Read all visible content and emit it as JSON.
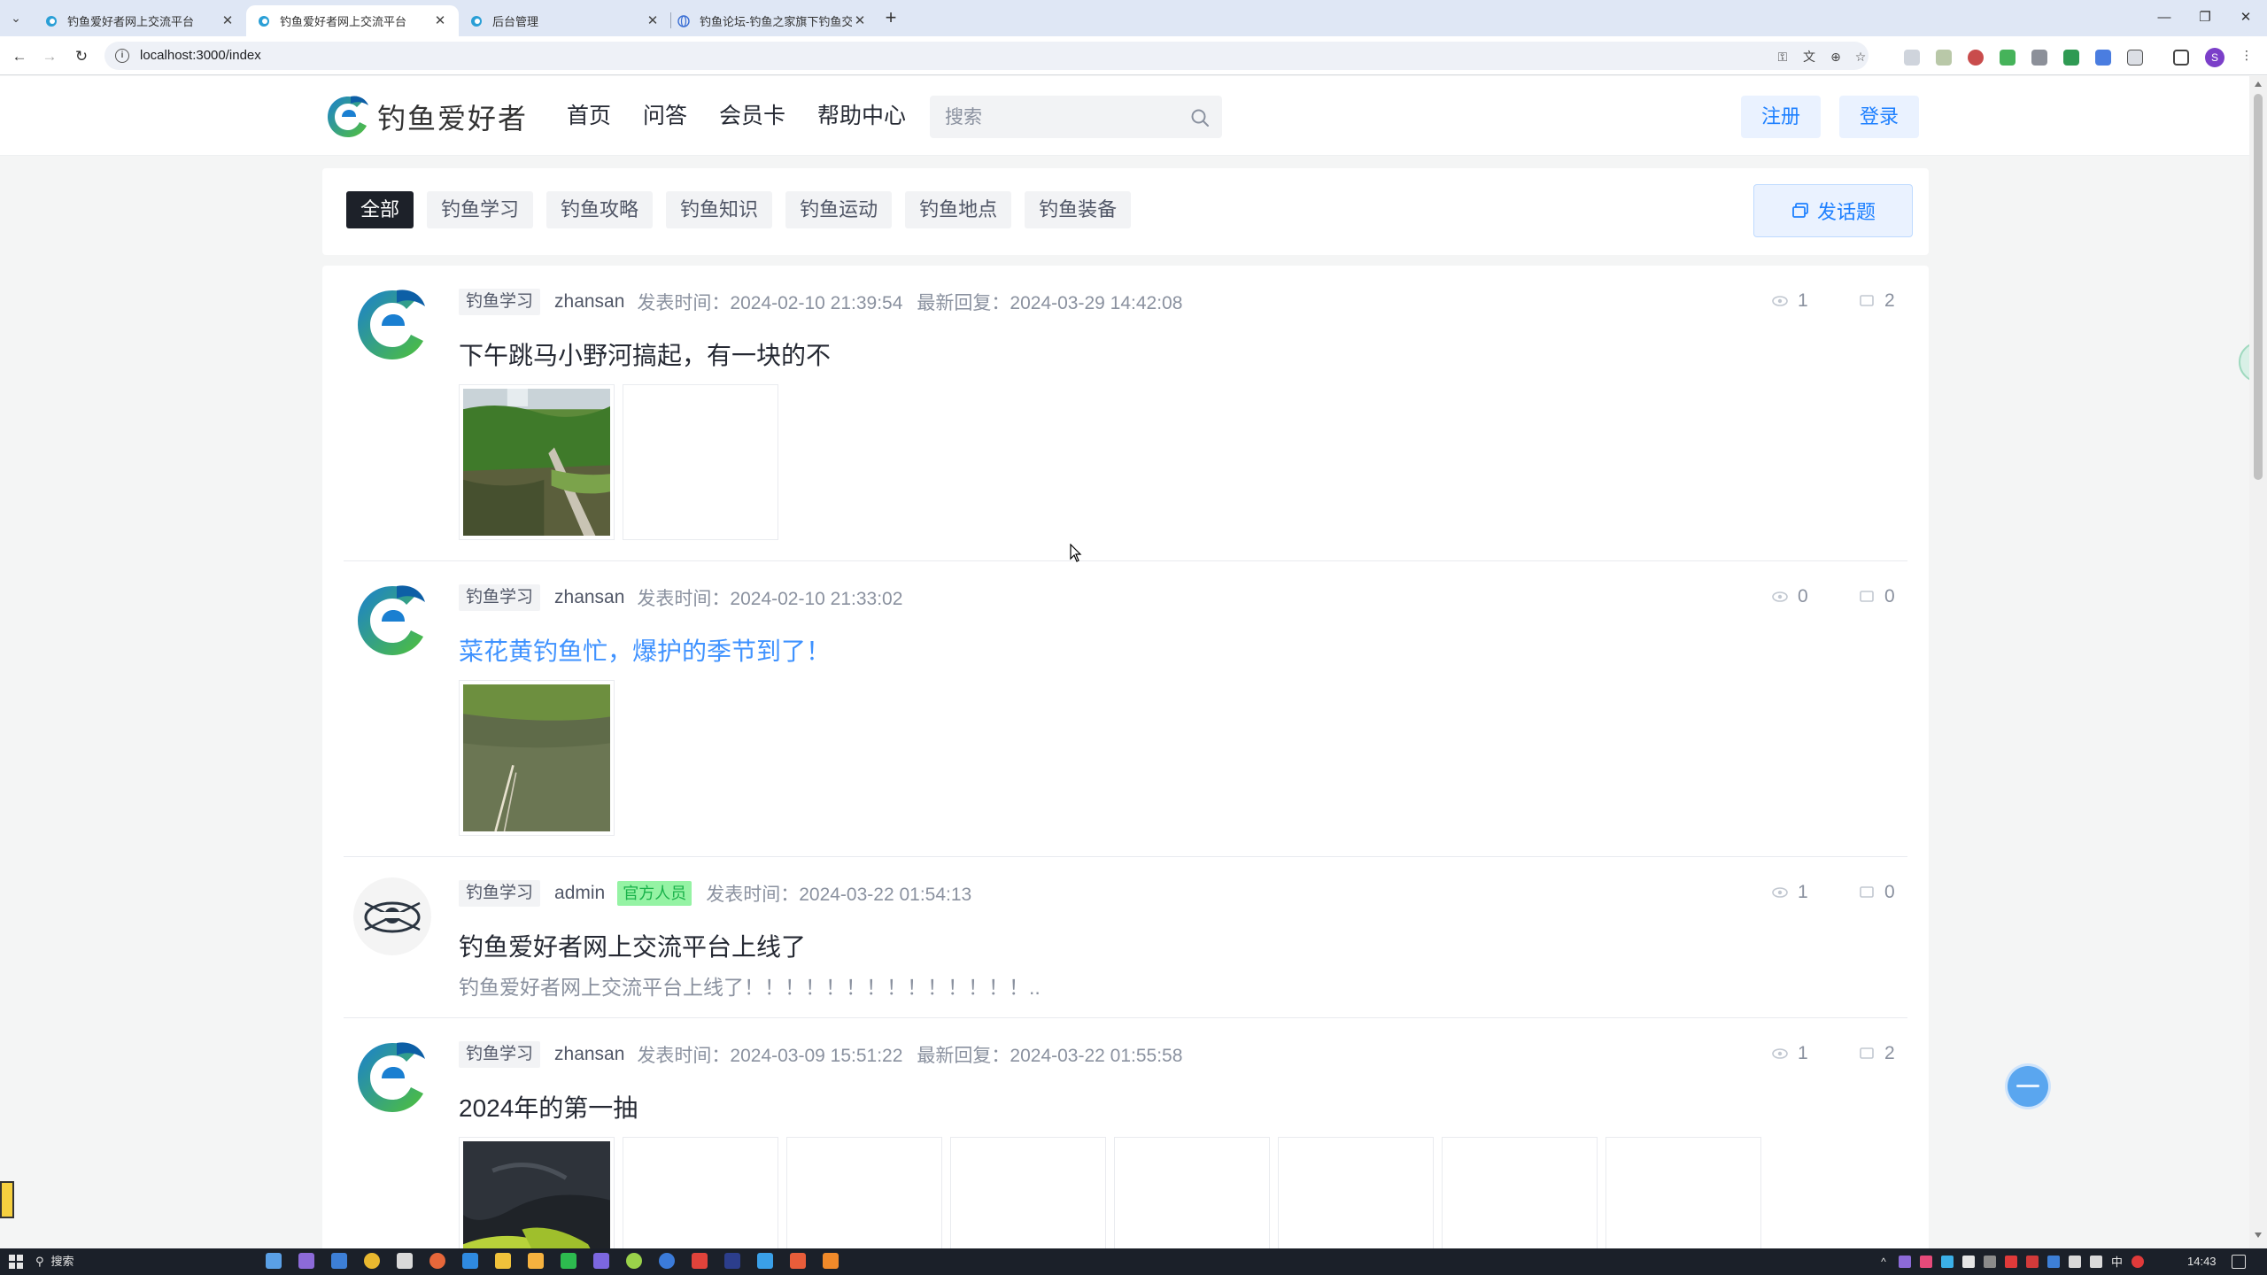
{
  "browser": {
    "tabs": [
      {
        "title": "钓鱼爱好者网上交流平台",
        "active": false
      },
      {
        "title": "钓鱼爱好者网上交流平台",
        "active": true
      },
      {
        "title": "后台管理",
        "active": false
      },
      {
        "title": "钓鱼论坛-钓鱼之家旗下钓鱼交...",
        "active": false
      }
    ],
    "url": "localhost:3000/index"
  },
  "header": {
    "logo_text": "钓鱼爱好者",
    "nav": [
      "首页",
      "问答",
      "会员卡",
      "帮助中心"
    ],
    "search_placeholder": "搜索",
    "register_label": "注册",
    "login_label": "登录"
  },
  "filters": {
    "chips": [
      "全部",
      "钓鱼学习",
      "钓鱼攻略",
      "钓鱼知识",
      "钓鱼运动",
      "钓鱼地点",
      "钓鱼装备"
    ],
    "active_index": 0,
    "post_button_label": "发话题"
  },
  "posts": [
    {
      "tag": "钓鱼学习",
      "author": "zhansan",
      "official_badge": "",
      "published": "发表时间：2024-02-10 21:39:54",
      "last_reply": "最新回复：2024-03-29 14:42:08",
      "views": "1",
      "comments": "2",
      "title": "下午跳马小野河搞起，有一块的不",
      "excerpt": ""
    },
    {
      "tag": "钓鱼学习",
      "author": "zhansan",
      "official_badge": "",
      "published": "发表时间：2024-02-10 21:33:02",
      "last_reply": "",
      "views": "0",
      "comments": "0",
      "title": "菜花黄钓鱼忙，爆护的季节到了！",
      "excerpt": ""
    },
    {
      "tag": "钓鱼学习",
      "author": "admin",
      "official_badge": "官方人员",
      "published": "发表时间：2024-03-22 01:54:13",
      "last_reply": "",
      "views": "1",
      "comments": "0",
      "title": "钓鱼爱好者网上交流平台上线了",
      "excerpt": "钓鱼爱好者网上交流平台上线了！！！！！！！！！！！！！！.."
    },
    {
      "tag": "钓鱼学习",
      "author": "zhansan",
      "official_badge": "",
      "published": "发表时间：2024-03-09 15:51:22",
      "last_reply": "最新回复：2024-03-22 01:55:58",
      "views": "1",
      "comments": "2",
      "title": "2024年的第一抽",
      "excerpt": ""
    }
  ],
  "taskbar": {
    "search_label": "搜索",
    "ime": "中",
    "time": "14:43"
  },
  "colors": {
    "accent": "#1e80ff",
    "accent_light": "#eaf2ff",
    "official_bg": "#95f3a4",
    "official_text": "#19b24a"
  },
  "icons": [
    "search-icon",
    "eye-icon",
    "comment-icon",
    "post-topic-icon",
    "site-logo-icon"
  ]
}
